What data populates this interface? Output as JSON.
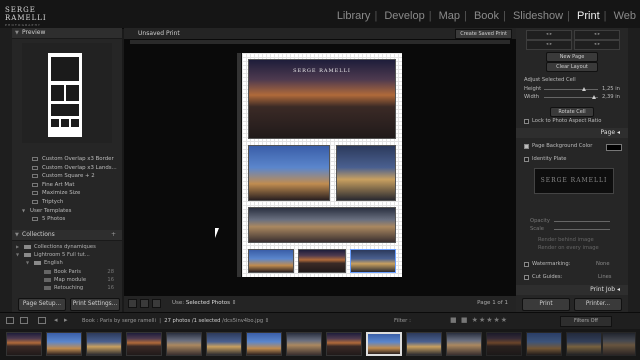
{
  "logo": {
    "line1": "SERGE RAMELLI",
    "line2": "PHOTOGRAPHY"
  },
  "modules": [
    "Library",
    "Develop",
    "Map",
    "Book",
    "Slideshow",
    "Print",
    "Web"
  ],
  "active_module": "Print",
  "left_panel": {
    "preview_title": "Preview",
    "templates": [
      "Custom Overlap x3 Border",
      "Custom Overlap x3 Lands...",
      "Custom Square + 2",
      "Fine Art Mat",
      "Maximize Size",
      "Triptych"
    ],
    "user_templates_label": "User Templates",
    "user_template_item": "5 Photos",
    "collections_title": "Collections",
    "collections": [
      {
        "label": "Collections dynamiques",
        "count": ""
      },
      {
        "label": "Lightroom 5 Full tut...",
        "count": ""
      },
      {
        "label": "English",
        "count": ""
      },
      {
        "label": "Book Paris",
        "count": "28"
      },
      {
        "label": "Map module",
        "count": "16"
      },
      {
        "label": "Retouching",
        "count": "16"
      }
    ],
    "page_setup": "Page Setup...",
    "print_settings": "Print Settings..."
  },
  "center": {
    "title": "Unsaved Print",
    "create_saved_print": "Create Saved Print",
    "use_label": "Use:",
    "use_value": "Selected Photos",
    "page_indicator": "Page 1 of 1"
  },
  "right_panel": {
    "new_page": "New Page",
    "clear_layout": "Clear Layout",
    "adjust_selected_cell": "Adjust Selected Cell",
    "height_label": "Height",
    "height_value": "1,25 in",
    "width_label": "Width",
    "width_value": "2,39 in",
    "rotate_cell": "Rotate Cell",
    "lock_aspect": "Lock to Photo Aspect Ratio",
    "page_section": "Page",
    "page_bg_color": "Page Background Color",
    "identity_plate": "Identity Plate",
    "identity_plate_text": "SERGE RAMELLI",
    "opacity_label": "Opacity",
    "scale_label": "Scale",
    "render_behind": "Render behind image",
    "render_every": "Render on every image",
    "watermarking": "Watermarking:",
    "watermark_value": "None",
    "cut_guides": "Cut Guides:",
    "cut_guides_value": "Lines",
    "print_job_section": "Print Job",
    "print_btn": "Print",
    "printer_btn": "Printer..."
  },
  "filmstrip": {
    "path": "Book : Paris by serge ramelli",
    "count": "27 photos",
    "selected": "/1 selected",
    "filename": "/dcs5inv4bo.jpg",
    "filter_label": "Filter :",
    "filters_off": "Filters Off"
  }
}
